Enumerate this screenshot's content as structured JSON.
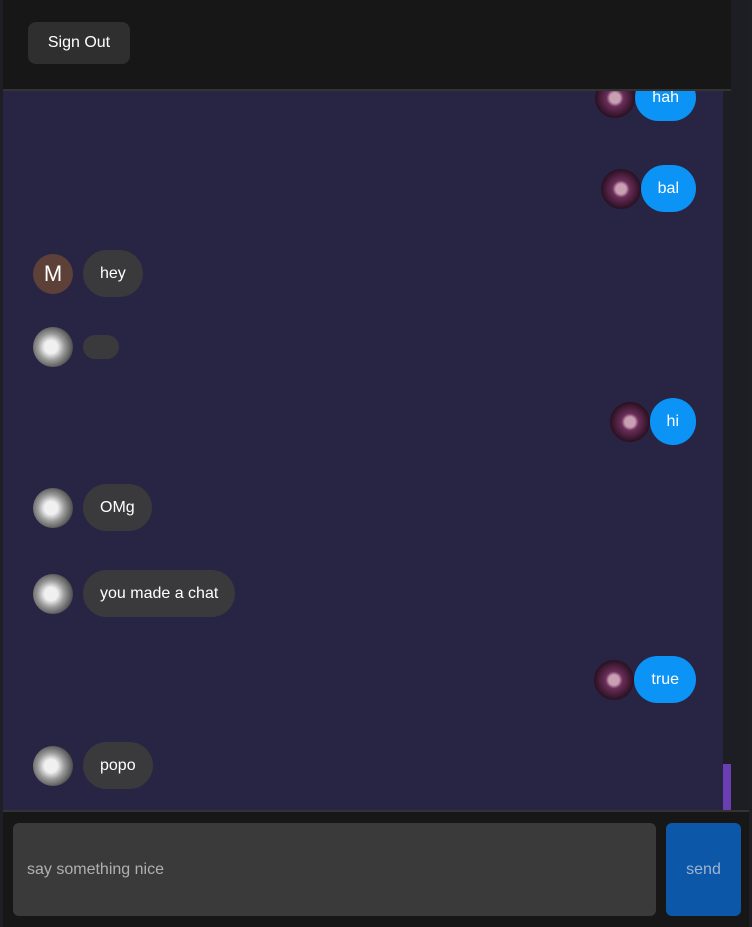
{
  "header": {
    "signout_label": "Sign Out"
  },
  "messages": [
    {
      "side": "sent",
      "text": "hah",
      "avatar": "purple-photo-avatar"
    },
    {
      "side": "sent",
      "text": "bal",
      "avatar": "purple-photo-avatar"
    },
    {
      "side": "received",
      "text": "hey",
      "avatar": "letter-avatar",
      "avatar_letter": "M"
    },
    {
      "side": "received",
      "text": "",
      "avatar": "gray-photo-avatar"
    },
    {
      "side": "sent",
      "text": "hi",
      "avatar": "purple-photo-avatar"
    },
    {
      "side": "received",
      "text": "OMg",
      "avatar": "gray-photo-avatar"
    },
    {
      "side": "received",
      "text": "you made a chat",
      "avatar": "gray-photo-avatar"
    },
    {
      "side": "sent",
      "text": "true",
      "avatar": "purple-photo-avatar"
    },
    {
      "side": "received",
      "text": "popo",
      "avatar": "gray-photo-avatar"
    }
  ],
  "composer": {
    "placeholder": "say something nice",
    "value": "",
    "send_label": "send"
  },
  "colors": {
    "sent_bubble": "#0b93f6",
    "received_bubble": "#3a3a3c",
    "chat_background": "#282443",
    "scroll_thumb": "#6a3fb3",
    "send_button": "#0c57a8"
  }
}
